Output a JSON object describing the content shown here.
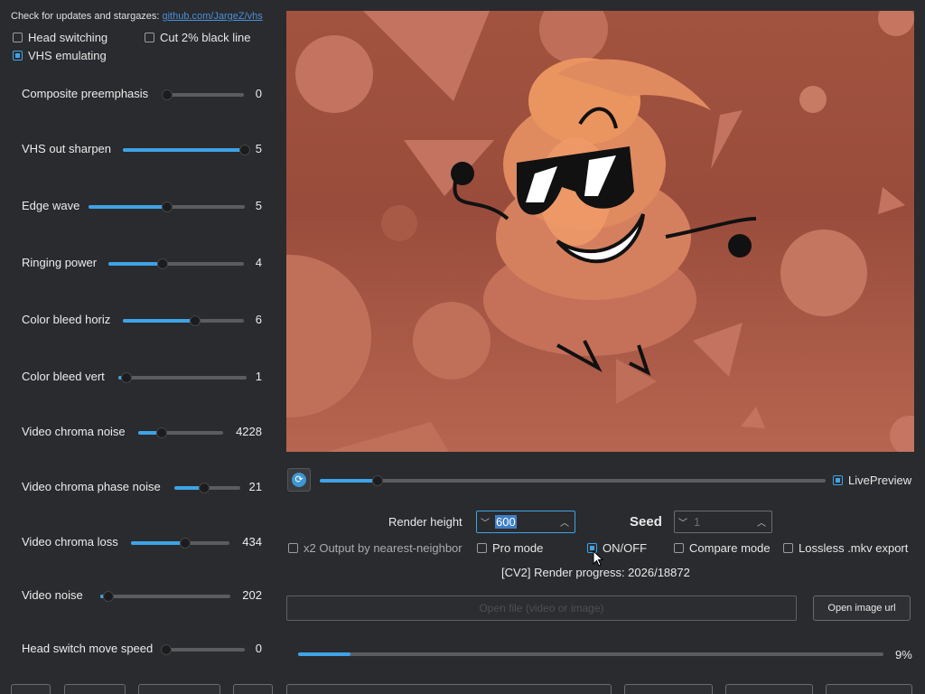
{
  "header": {
    "update_text": "Check for updates and stargazes:",
    "update_link": "github.com/JargeZ/vhs"
  },
  "options": {
    "head_switching": {
      "label": "Head switching",
      "checked": false
    },
    "cut_black_line": {
      "label": "Cut 2% black line",
      "checked": false
    },
    "vhs_emulating": {
      "label": "VHS emulating",
      "checked": true
    }
  },
  "sliders": [
    {
      "label": "Composite preemphasis",
      "value": "0",
      "fraction": 0.0
    },
    {
      "label": "VHS out sharpen",
      "value": "5",
      "fraction": 1.0
    },
    {
      "label": "Edge wave",
      "value": "5",
      "fraction": 0.5
    },
    {
      "label": "Ringing power",
      "value": "4",
      "fraction": 0.4
    },
    {
      "label": "Color bleed horiz",
      "value": "6",
      "fraction": 0.6
    },
    {
      "label": "Color bleed vert",
      "value": "1",
      "fraction": 0.06
    },
    {
      "label": "Video chroma noise",
      "value": "4228",
      "fraction": 0.28
    },
    {
      "label": "Video chroma phase noise",
      "value": "21",
      "fraction": 0.45
    },
    {
      "label": "Video chroma loss",
      "value": "434",
      "fraction": 0.55
    },
    {
      "label": "Video noise",
      "value": "202",
      "fraction": 0.06
    },
    {
      "label": "Head switch move speed",
      "value": "0",
      "fraction": 0.0
    }
  ],
  "preview": {
    "timeline_fraction": 0.115,
    "live_preview": {
      "label": "LivePreview",
      "checked": true
    }
  },
  "render": {
    "height_label": "Render height",
    "height_value": "600",
    "seed_label": "Seed",
    "seed_value": "1"
  },
  "modes": {
    "x2_output": {
      "label": "x2 Output by nearest-neighbor",
      "checked": false
    },
    "pro_mode": {
      "label": "Pro mode",
      "checked": false
    },
    "on_off": {
      "label": "ON/OFF",
      "checked": true
    },
    "compare_mode": {
      "label": "Compare mode",
      "checked": false
    },
    "lossless_export": {
      "label": "Lossless .mkv export",
      "checked": false
    }
  },
  "progress": {
    "text": "[CV2] Render progress: 2026/18872",
    "percent_label": "9%",
    "fraction": 0.09
  },
  "files": {
    "open_file_label": "Open file (video or image)",
    "open_url_label": "Open image url"
  },
  "colors": {
    "accent": "#3ea3e8",
    "background": "#2a2b2e"
  }
}
